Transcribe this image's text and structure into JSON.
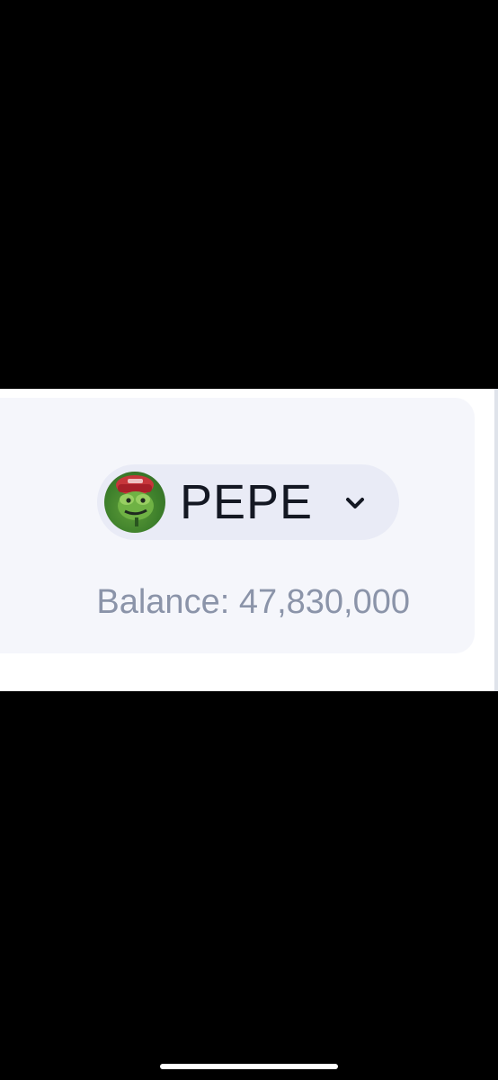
{
  "token_card": {
    "token": {
      "symbol": "PEPE",
      "logo_icon": "pepe-frog-icon",
      "dropdown_icon": "chevron-down-icon"
    },
    "balance_text": "Balance: 47,830,000"
  },
  "colors": {
    "background": "#000000",
    "card": "#f5f6fb",
    "selector": "#e9ebf6",
    "symbol_text": "#141823",
    "balance_text": "#8b94a9",
    "logo_green": "#4f8f32",
    "logo_hat": "#c7363b"
  }
}
